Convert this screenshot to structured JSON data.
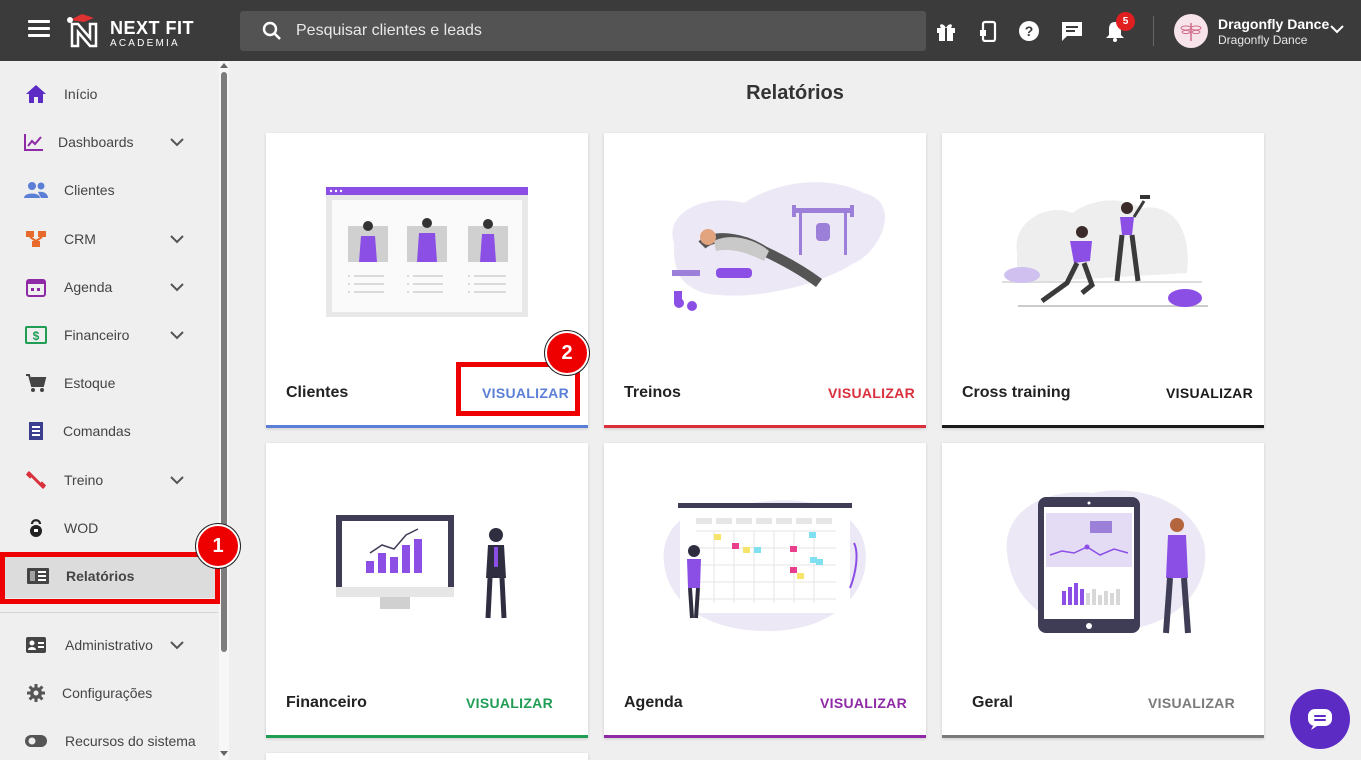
{
  "header": {
    "logo_line1": "NEXT FIT",
    "logo_line2": "ACADEMIA",
    "search_placeholder": "Pesquisar clientes e leads",
    "notification_count": "5",
    "user_name": "Dragonfly Dance",
    "user_sub": "Dragonfly Dance"
  },
  "sidebar": {
    "items": [
      {
        "label": "Início",
        "icon": "home-icon",
        "expandable": false
      },
      {
        "label": "Dashboards",
        "icon": "chart-line-icon",
        "expandable": true
      },
      {
        "label": "Clientes",
        "icon": "people-icon",
        "expandable": false
      },
      {
        "label": "CRM",
        "icon": "crm-icon",
        "expandable": true
      },
      {
        "label": "Agenda",
        "icon": "calendar-icon",
        "expandable": true
      },
      {
        "label": "Financeiro",
        "icon": "money-icon",
        "expandable": true
      },
      {
        "label": "Estoque",
        "icon": "cart-icon",
        "expandable": false
      },
      {
        "label": "Comandas",
        "icon": "receipt-icon",
        "expandable": false
      },
      {
        "label": "Treino",
        "icon": "dumbbell-icon",
        "expandable": true
      },
      {
        "label": "WOD",
        "icon": "kettlebell-icon",
        "expandable": false
      },
      {
        "label": "Relatórios",
        "icon": "report-icon",
        "expandable": false,
        "active": true
      },
      {
        "label": "Administrativo",
        "icon": "id-card-icon",
        "expandable": true
      },
      {
        "label": "Configurações",
        "icon": "gear-icon",
        "expandable": false
      },
      {
        "label": "Recursos do sistema",
        "icon": "toggle-icon",
        "expandable": false
      }
    ]
  },
  "main": {
    "title": "Relatórios",
    "cards": [
      {
        "title": "Clientes",
        "action": "VISUALIZAR",
        "color": "#5b7fd6"
      },
      {
        "title": "Treinos",
        "action": "VISUALIZAR",
        "color": "#d9303c"
      },
      {
        "title": "Cross training",
        "action": "VISUALIZAR",
        "color": "#1a1a1a"
      },
      {
        "title": "Financeiro",
        "action": "VISUALIZAR",
        "color": "#1f9d55"
      },
      {
        "title": "Agenda",
        "action": "VISUALIZAR",
        "color": "#8e2aa6"
      },
      {
        "title": "Geral",
        "action": "VISUALIZAR",
        "color": "#7a7a7a"
      }
    ]
  },
  "annotations": {
    "step1": "1",
    "step2": "2"
  },
  "colors": {
    "accent_purple": "#8c4fe6",
    "annotation_red": "#ee0000"
  }
}
